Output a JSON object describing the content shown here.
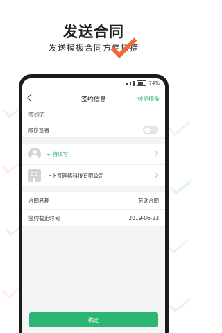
{
  "promo": {
    "title": "发送合同",
    "subtitle": "发送模板合同方便快捷"
  },
  "statusbar": {
    "battery": "74%"
  },
  "navbar": {
    "title": "签约信息",
    "action": "预览模板",
    "back_icon": "chevron-left-icon"
  },
  "signers_section": {
    "label": "签约方",
    "order_toggle_label": "顺序签署",
    "order_toggle_on": false
  },
  "signers": [
    {
      "name": "+ 待填写",
      "icon": "user-avatar-icon",
      "pending": true
    },
    {
      "name": "上上签网络科技有限公司",
      "icon": "company-icon",
      "pending": false
    }
  ],
  "contract_info": {
    "name_label": "合同名称",
    "name_value": "劳动合同",
    "deadline_label": "签约截止时间",
    "deadline_value": "2019-06-23"
  },
  "confirm_label": "确定",
  "colors": {
    "accent": "#2bb673",
    "promo_check": "#f26a3c"
  }
}
